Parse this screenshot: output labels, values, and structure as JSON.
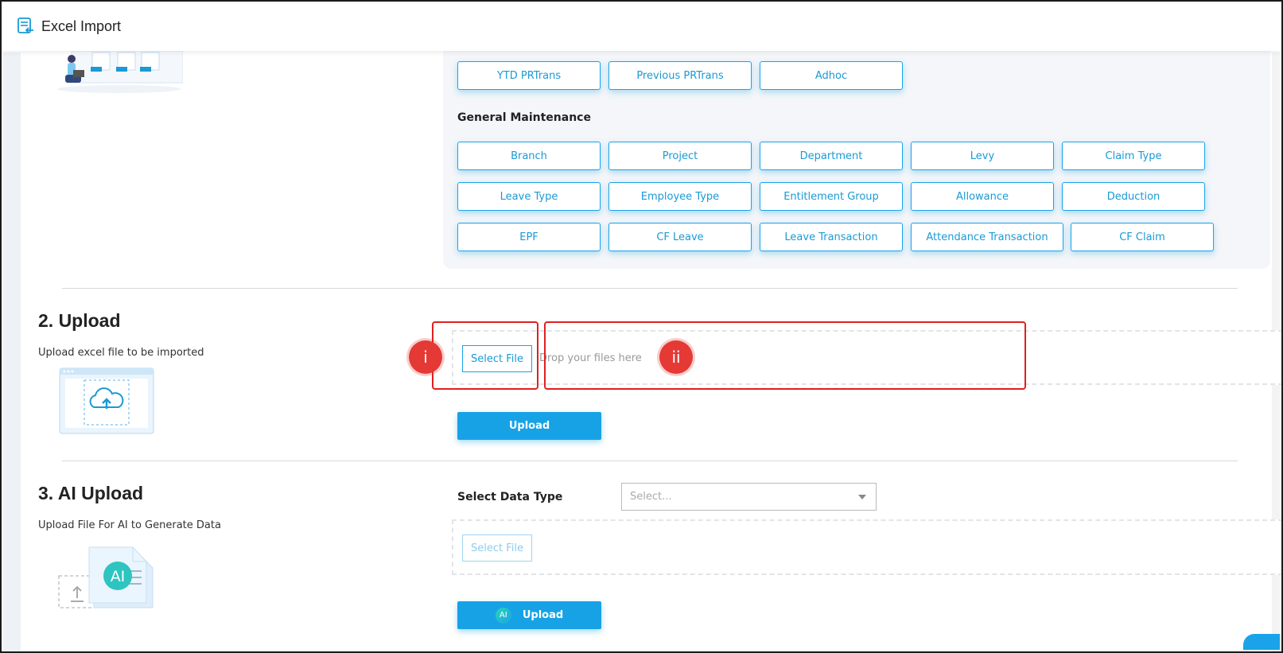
{
  "header": {
    "title": "Excel Import",
    "icon": "import-document-icon"
  },
  "templates": {
    "top_row": [
      "YTD PRTrans",
      "Previous PRTrans",
      "Adhoc"
    ],
    "general_title": "General Maintenance",
    "row1": [
      "Branch",
      "Project",
      "Department",
      "Levy",
      "Claim Type"
    ],
    "row2": [
      "Leave Type",
      "Employee Type",
      "Entitlement Group",
      "Allowance",
      "Deduction"
    ],
    "row3": [
      "EPF",
      "CF Leave",
      "Leave Transaction",
      "Attendance Transaction",
      "CF Claim"
    ]
  },
  "upload": {
    "title": "2. Upload",
    "subtitle": "Upload excel file to be imported",
    "select_file": "Select File",
    "drop_text": "Drop your files here",
    "upload_button": "Upload",
    "markers": [
      "i",
      "ii"
    ]
  },
  "ai_upload": {
    "title": "3. AI Upload",
    "subtitle": "Upload File For AI to Generate Data",
    "data_type_label": "Select Data Type",
    "data_type_placeholder": "Select...",
    "select_file": "Select File",
    "badge": "AI",
    "upload_button": "Upload"
  },
  "colors": {
    "accent": "#17a2e6",
    "marker": "#e53935"
  }
}
